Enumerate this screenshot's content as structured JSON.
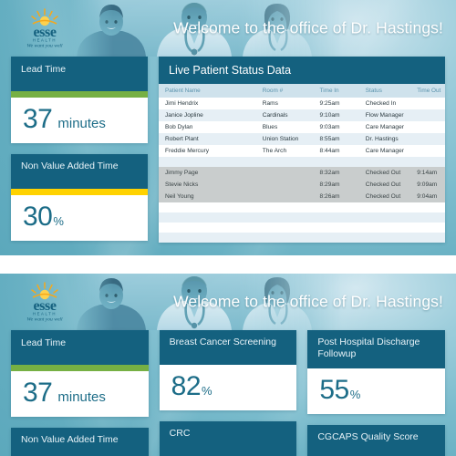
{
  "brand": {
    "name": "esse",
    "sub": "HEALTH",
    "tagline": "We want you well",
    "logo_icon": "sunrise-icon"
  },
  "header": {
    "title": "Welcome to the office of Dr. Hastings!",
    "photo_alt": "medical-staff-photo"
  },
  "colors": {
    "card_header": "#14617f",
    "accent_green": "#76b043",
    "accent_yellow": "#ffd200",
    "value_text": "#1d6d88",
    "background": "#63adc0"
  },
  "screen_top": {
    "cards": [
      {
        "title": "Lead Time",
        "value": "37",
        "unit": "minutes",
        "accent": "green"
      },
      {
        "title": "Non Value Added Time",
        "value": "30",
        "unit": "%",
        "accent": "yellow"
      }
    ],
    "table": {
      "title": "Live Patient Status Data",
      "columns": [
        "Patient Name",
        "Room  #",
        "Time In",
        "Status",
        "Time Out"
      ],
      "rows": [
        {
          "name": "Jimi Hendrix",
          "room": "Rams",
          "time_in": "9:25am",
          "status": "Checked In",
          "time_out": ""
        },
        {
          "name": "Janice Jopline",
          "room": "Cardinals",
          "time_in": "9:10am",
          "status": "Flow Manager",
          "time_out": ""
        },
        {
          "name": "Bob Dylan",
          "room": "Blues",
          "time_in": "9:03am",
          "status": "Care Manager",
          "time_out": ""
        },
        {
          "name": "Robert Plant",
          "room": "Union Station",
          "time_in": "8:55am",
          "status": "Dr. Hastings",
          "time_out": ""
        },
        {
          "name": "Freddie Mercury",
          "room": "The Arch",
          "time_in": "8:44am",
          "status": "Care Manager",
          "time_out": ""
        }
      ],
      "checked_out_rows": [
        {
          "name": "Jimmy Page",
          "room": "",
          "time_in": "8:32am",
          "status": "Checked Out",
          "time_out": "9:14am"
        },
        {
          "name": "Stevie Nicks",
          "room": "",
          "time_in": "8:29am",
          "status": "Checked Out",
          "time_out": "9:09am"
        },
        {
          "name": "Neil Young",
          "room": "",
          "time_in": "8:26am",
          "status": "Checked Out",
          "time_out": "9:04am"
        }
      ]
    }
  },
  "screen_bottom": {
    "columns": [
      {
        "cards": [
          {
            "title": "Lead Time",
            "value": "37",
            "unit": "minutes",
            "accent": "green"
          },
          {
            "title": "Non Value Added Time",
            "value": "",
            "unit": "",
            "accent": "none"
          }
        ]
      },
      {
        "cards": [
          {
            "title": "Breast Cancer Screening",
            "value": "82",
            "unit": "%",
            "accent": "none"
          },
          {
            "title": "CRC",
            "value": "",
            "unit": "",
            "accent": "none"
          }
        ]
      },
      {
        "cards": [
          {
            "title": "Post Hospital Discharge Followup",
            "value": "55",
            "unit": "%",
            "accent": "none"
          },
          {
            "title": "CGCAPS Quality Score",
            "value": "",
            "unit": "",
            "accent": "none"
          }
        ]
      }
    ]
  }
}
